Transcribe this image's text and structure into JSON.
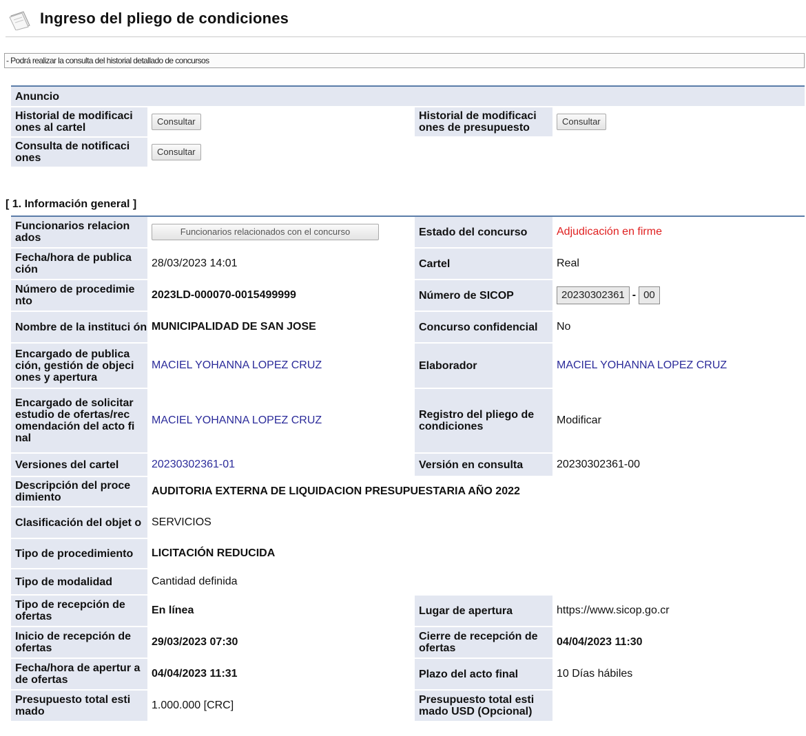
{
  "header": {
    "title": "Ingreso del pliego de condiciones",
    "icon": "document-icon"
  },
  "notice": "- Podrá realizar la consulta del historial detallado de concursos",
  "anuncio": {
    "title": "Anuncio",
    "rows": [
      {
        "label_left": "Historial de modificaci ones al cartel",
        "button_left": "Consultar",
        "label_right": "Historial de modificaci ones de presupuesto",
        "button_right": "Consultar"
      },
      {
        "label_left": "Consulta de notificaci ones",
        "button_left": "Consultar"
      }
    ]
  },
  "section1": {
    "title": "[ 1. Información general ]",
    "funcionarios_label": "Funcionarios relacion ados",
    "funcionarios_button": "Funcionarios relacionados con el concurso",
    "estado_label": "Estado del concurso",
    "estado_value": "Adjudicación en firme",
    "fecha_pub_label": "Fecha/hora de publica ción",
    "fecha_pub_value": "28/03/2023 14:01",
    "cartel_label": "Cartel",
    "cartel_value": "Real",
    "num_proc_label": "Número de procedimie nto",
    "num_proc_value": "2023LD-000070-0015499999",
    "num_sicop_label": "Número de SICOP",
    "num_sicop_value": "20230302361",
    "num_sicop_sep": "-",
    "num_sicop_suffix": "00",
    "institucion_label": "Nombre de la instituci ón",
    "institucion_value": "MUNICIPALIDAD DE SAN JOSE",
    "confidencial_label": "Concurso confidencial",
    "confidencial_value": "No",
    "encargado_pub_label": "Encargado de publica ción, gestión de objeci ones y apertura",
    "encargado_pub_value": "MACIEL YOHANNA LOPEZ CRUZ",
    "elaborador_label": "Elaborador",
    "elaborador_value": "MACIEL YOHANNA LOPEZ CRUZ",
    "encargado_sol_label": "Encargado de solicitar estudio de ofertas/rec omendación del acto fi nal",
    "encargado_sol_value": "MACIEL YOHANNA LOPEZ CRUZ",
    "registro_label": "Registro del pliego de condiciones",
    "registro_value": "Modificar",
    "versiones_label": "Versiones del cartel",
    "versiones_value": "20230302361-01",
    "version_consulta_label": "Versión en consulta",
    "version_consulta_value": "20230302361-00",
    "descripcion_label": "Descripción del proce dimiento",
    "descripcion_value": "AUDITORIA EXTERNA DE LIQUIDACION PRESUPUESTARIA AÑO 2022",
    "clasificacion_label": "Clasificación del objet o",
    "clasificacion_value": "SERVICIOS",
    "tipo_proc_label": "Tipo de procedimiento",
    "tipo_proc_value": "LICITACIÓN REDUCIDA",
    "tipo_mod_label": "Tipo de modalidad",
    "tipo_mod_value": "Cantidad definida",
    "tipo_recep_label": "Tipo de recepción de ofertas",
    "tipo_recep_value": "En línea",
    "lugar_label": "Lugar de apertura",
    "lugar_value": "https://www.sicop.go.cr",
    "inicio_label": "Inicio de recepción de ofertas",
    "inicio_value": "29/03/2023 07:30",
    "cierre_label": "Cierre de recepción de ofertas",
    "cierre_value": "04/04/2023 11:30",
    "apertura_label": "Fecha/hora de apertur a de ofertas",
    "apertura_value": "04/04/2023 11:31",
    "plazo_label": "Plazo del acto final",
    "plazo_value": "10 Días hábiles",
    "presupuesto_label": "Presupuesto total esti mado",
    "presupuesto_value": "1.000.000 [CRC]",
    "presupuesto_usd_label": "Presupuesto total esti mado USD (Opcional)",
    "presupuesto_usd_value": ""
  }
}
